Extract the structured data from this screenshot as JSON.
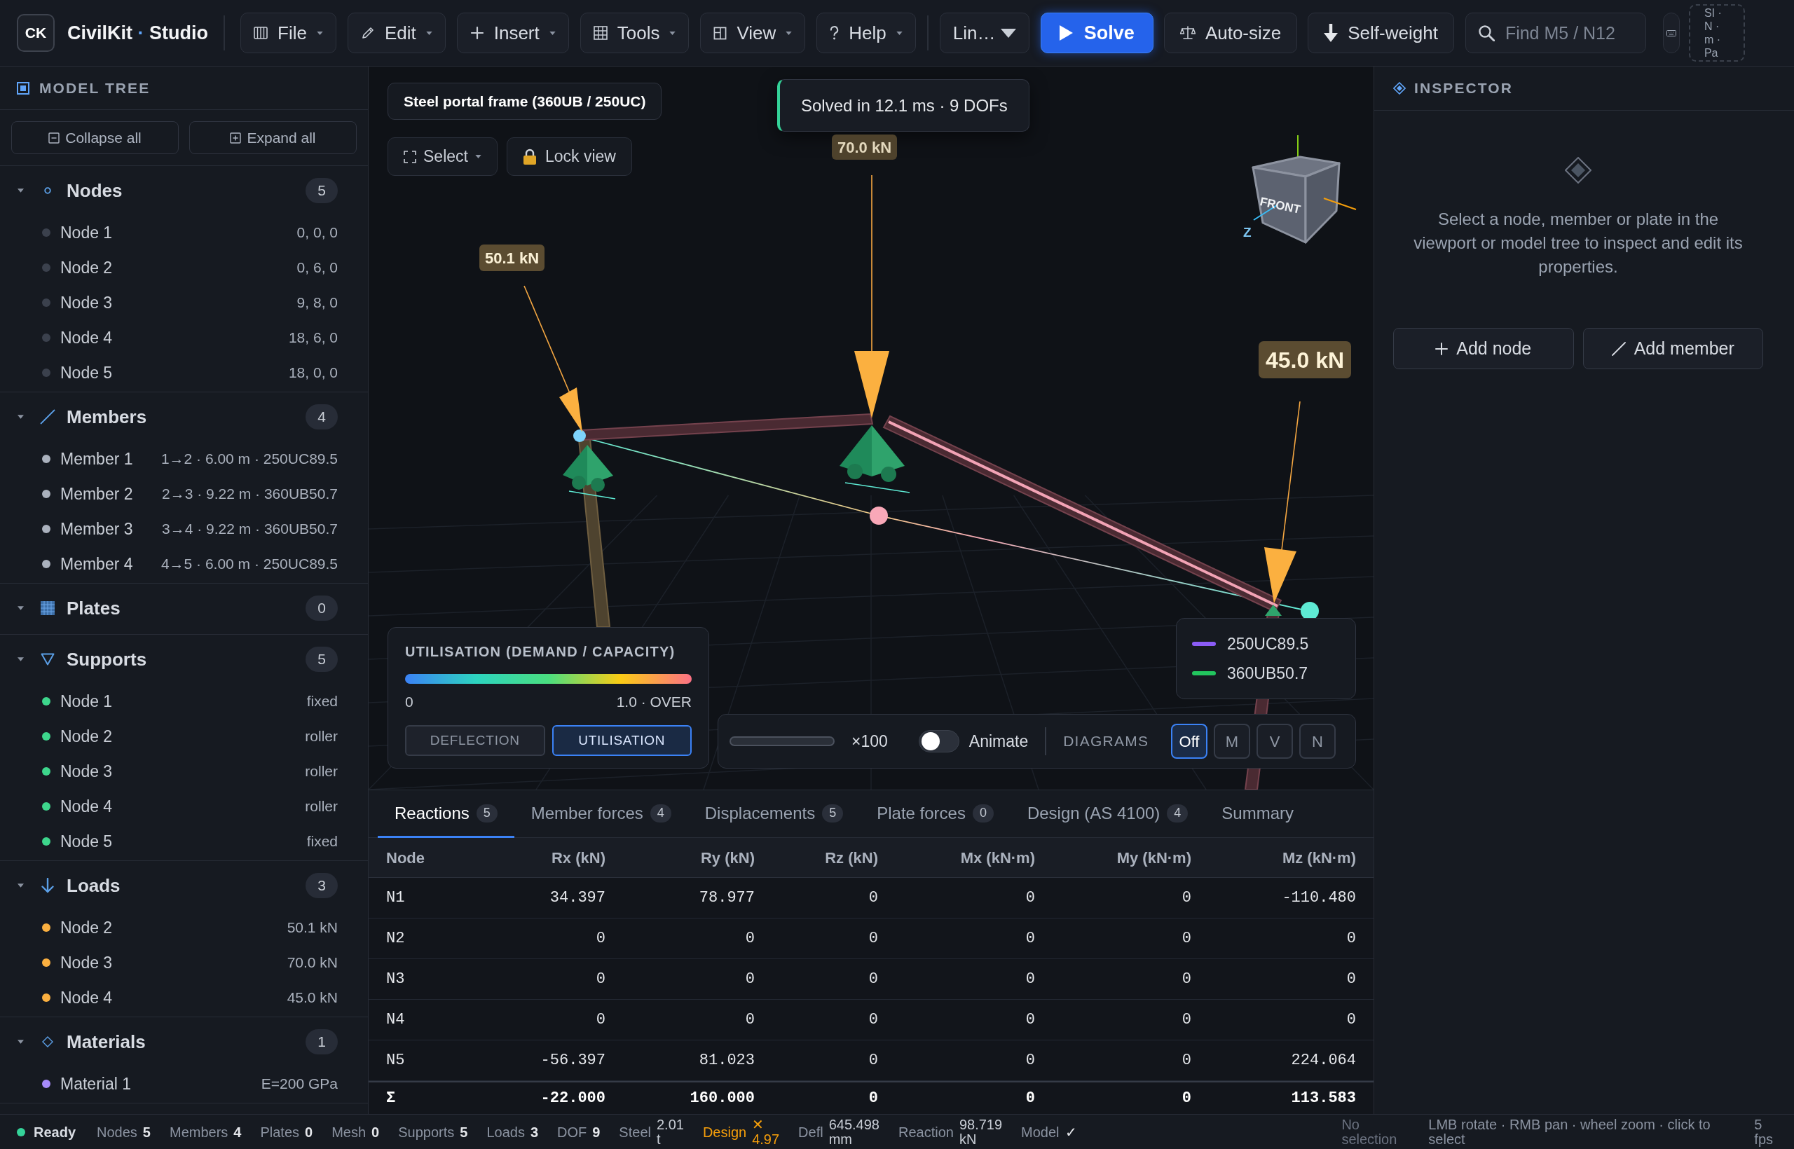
{
  "app": {
    "logo": "CK",
    "name": "CivilKit",
    "separator": "·",
    "edition": "Studio"
  },
  "menus": [
    "File",
    "Edit",
    "Insert",
    "Tools",
    "View",
    "Help"
  ],
  "analysis_type": {
    "value": "Lin…"
  },
  "actions": [
    {
      "label": "Solve",
      "kind": "primary"
    },
    {
      "label": "Auto-size",
      "kind": "secondary"
    },
    {
      "label": "Self-weight",
      "kind": "secondary"
    }
  ],
  "search": {
    "placeholder": "Find M5 / N12"
  },
  "units": {
    "value": "SI · N · m · Pa"
  },
  "model_tree": {
    "title": "MODEL TREE",
    "actions": [
      "Collapse all",
      "Expand all"
    ],
    "sections": [
      {
        "label": "Nodes",
        "count": "5",
        "expanded": true,
        "items": [
          {
            "label": "Node 1",
            "value": "0, 0, 0",
            "color": "#3b414d"
          },
          {
            "label": "Node 2",
            "value": "0, 6, 0",
            "color": "#3b414d"
          },
          {
            "label": "Node 3",
            "value": "9, 8, 0",
            "color": "#3b414d"
          },
          {
            "label": "Node 4",
            "value": "18, 6, 0",
            "color": "#3b414d"
          },
          {
            "label": "Node 5",
            "value": "18, 0, 0",
            "color": "#3b414d"
          }
        ]
      },
      {
        "label": "Members",
        "count": "4",
        "expanded": true,
        "items": [
          {
            "label": "Member 1",
            "value": "1→2 · 6.00 m · 250UC89.5",
            "color": "#aab1bd"
          },
          {
            "label": "Member 2",
            "value": "2→3 · 9.22 m · 360UB50.7",
            "color": "#aab1bd"
          },
          {
            "label": "Member 3",
            "value": "3→4 · 9.22 m · 360UB50.7",
            "color": "#aab1bd"
          },
          {
            "label": "Member 4",
            "value": "4→5 · 6.00 m · 250UC89.5",
            "color": "#aab1bd"
          }
        ]
      },
      {
        "label": "Plates",
        "count": "0",
        "expanded": true
      },
      {
        "label": "Supports",
        "count": "5",
        "expanded": true,
        "items": [
          {
            "label": "Node 1",
            "value": "fixed",
            "color": "#3dd68c"
          },
          {
            "label": "Node 2",
            "value": "roller",
            "color": "#3dd68c"
          },
          {
            "label": "Node 3",
            "value": "roller",
            "color": "#3dd68c"
          },
          {
            "label": "Node 4",
            "value": "roller",
            "color": "#3dd68c"
          },
          {
            "label": "Node 5",
            "value": "fixed",
            "color": "#3dd68c"
          }
        ]
      },
      {
        "label": "Loads",
        "count": "3",
        "expanded": true,
        "items": [
          {
            "label": "Node 2",
            "value": "50.1 kN",
            "color": "#fbb040"
          },
          {
            "label": "Node 3",
            "value": "70.0 kN",
            "color": "#fbb040"
          },
          {
            "label": "Node 4",
            "value": "45.0 kN",
            "color": "#fbb040"
          }
        ]
      },
      {
        "label": "Materials",
        "count": "1",
        "expanded": true,
        "items": [
          {
            "label": "Material 1",
            "value": "E=200 GPa",
            "color": "#a78bfa"
          }
        ]
      }
    ]
  },
  "viewport": {
    "title": "Steel portal frame (360UB / 250UC)",
    "select_tool": "Select",
    "lock_button": "Lock view",
    "toast": "Solved in 12.1 ms · 9 DOFs",
    "load_labels": [
      "50.1 kN",
      "70.0 kN",
      "45.0 kN"
    ],
    "view_cube": {
      "face": "FRONT",
      "axis": "Z"
    },
    "result_legend": {
      "title": "UTILISATION (DEMAND / CAPACITY)",
      "min": "0",
      "max": "1.0 · OVER",
      "modes": [
        {
          "label": "DEFLECTION",
          "selected": false
        },
        {
          "label": "UTILISATION",
          "selected": true
        }
      ]
    },
    "section_legend": [
      {
        "label": "250UC89.5",
        "color": "#8b5cf6"
      },
      {
        "label": "360UB50.7",
        "color": "#22c55e"
      }
    ],
    "scale": "×100",
    "animate": {
      "label": "Animate",
      "on": false
    },
    "diagrams": {
      "label": "DIAGRAMS",
      "options": [
        {
          "label": "Off",
          "selected": true
        },
        {
          "label": "M",
          "selected": false
        },
        {
          "label": "V",
          "selected": false
        },
        {
          "label": "N",
          "selected": false
        }
      ]
    }
  },
  "results": {
    "tabs": [
      {
        "label": "Reactions",
        "count": "5",
        "selected": true
      },
      {
        "label": "Member forces",
        "count": "4",
        "selected": false
      },
      {
        "label": "Displacements",
        "count": "5",
        "selected": false
      },
      {
        "label": "Plate forces",
        "count": "0",
        "selected": false
      },
      {
        "label": "Design (AS 4100)",
        "count": "4",
        "selected": false
      },
      {
        "label": "Summary",
        "selected": false
      }
    ],
    "columns": [
      "Node",
      "Rx (kN)",
      "Ry (kN)",
      "Rz (kN)",
      "Mx (kN·m)",
      "My (kN·m)",
      "Mz (kN·m)"
    ],
    "rows": [
      [
        "N1",
        "34.397",
        "78.977",
        "0",
        "0",
        "0",
        "-110.480"
      ],
      [
        "N2",
        "0",
        "0",
        "0",
        "0",
        "0",
        "0"
      ],
      [
        "N3",
        "0",
        "0",
        "0",
        "0",
        "0",
        "0"
      ],
      [
        "N4",
        "0",
        "0",
        "0",
        "0",
        "0",
        "0"
      ],
      [
        "N5",
        "-56.397",
        "81.023",
        "0",
        "0",
        "0",
        "224.064"
      ]
    ],
    "totals": [
      "Σ",
      "-22.000",
      "160.000",
      "0",
      "0",
      "0",
      "113.583"
    ]
  },
  "inspector": {
    "title": "INSPECTOR",
    "message": "Select a node, member or plate in the viewport or model tree to inspect and edit its properties.",
    "actions": [
      "Add node",
      "Add member"
    ]
  },
  "status_bar": {
    "state": "Ready",
    "items": [
      {
        "label": "Nodes",
        "value": "5",
        "kind": "count"
      },
      {
        "label": "Members",
        "value": "4",
        "kind": "count"
      },
      {
        "label": "Plates",
        "value": "0",
        "kind": "count"
      },
      {
        "label": "Mesh",
        "value": "0",
        "kind": "count"
      },
      {
        "label": "Supports",
        "value": "5",
        "kind": "count"
      },
      {
        "label": "Loads",
        "value": "3",
        "kind": "count"
      },
      {
        "label": "DOF",
        "value": "9",
        "kind": "count"
      },
      {
        "label": "Steel",
        "value": "2.01 t",
        "kind": "metric"
      },
      {
        "label": "Design",
        "value": "✕ 4.97",
        "kind": "warning"
      },
      {
        "label": "Defl",
        "value": "645.498 mm",
        "kind": "metric"
      },
      {
        "label": "Reaction",
        "value": "98.719 kN",
        "kind": "metric"
      },
      {
        "label": "Model",
        "value": "✓",
        "kind": "check"
      }
    ],
    "selection": "No selection",
    "hint": "LMB rotate · RMB pan · wheel zoom · click to select",
    "fps": "5 fps"
  }
}
